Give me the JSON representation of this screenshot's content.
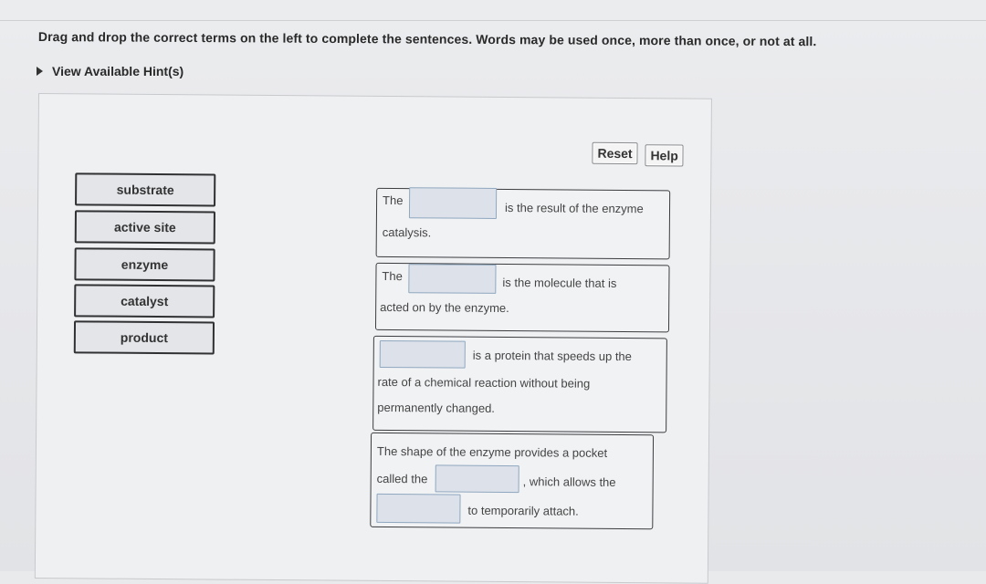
{
  "instructions": "Drag and drop the correct terms on the left to complete the sentences. Words may be used once, more than once, or not at all.",
  "hint": {
    "label": "View Available Hint(s)",
    "icon": "triangle-right-icon"
  },
  "toolbar": {
    "reset_label": "Reset",
    "help_label": "Help"
  },
  "terms": [
    {
      "label": "substrate"
    },
    {
      "label": "active site"
    },
    {
      "label": "enzyme"
    },
    {
      "label": "catalyst"
    },
    {
      "label": "product"
    }
  ],
  "sentences": [
    {
      "parts": [
        "The",
        "is the result of the enzyme",
        "catalysis."
      ]
    },
    {
      "parts": [
        "The",
        "is the molecule that is",
        "acted on by the enzyme."
      ]
    },
    {
      "parts": [
        "is a protein that speeds up the",
        "rate of a chemical reaction without being",
        "permanently changed."
      ]
    },
    {
      "parts": [
        "The shape of the enzyme provides a pocket",
        "called the",
        ", which allows the",
        "to temporarily attach."
      ]
    }
  ]
}
